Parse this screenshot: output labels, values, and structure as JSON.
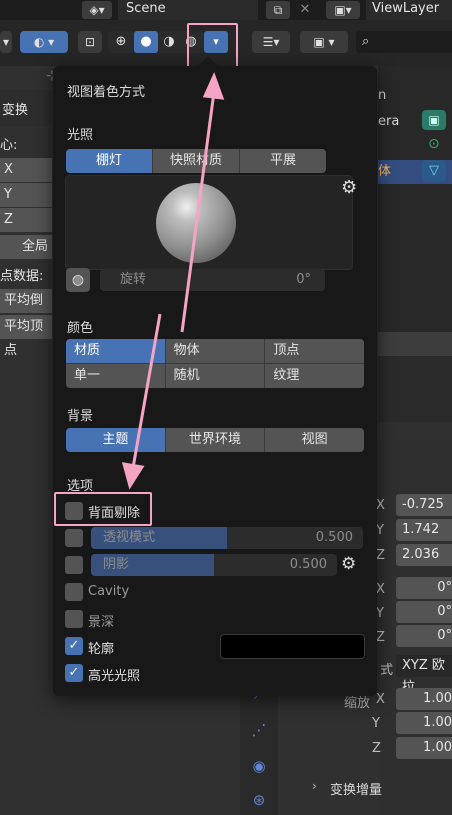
{
  "topbar": {
    "scene_label": "Scene",
    "viewlayer_label": "ViewLayer"
  },
  "left_panel": {
    "title": "变换",
    "center_label": "心:",
    "axes": [
      "X",
      "Y",
      "Z"
    ],
    "global_btn": "全局",
    "vertex_data_label": "点数据:",
    "avg_bevel": "平均倒角",
    "avg_vertex": "平均顶点"
  },
  "outliner": {
    "row_n": "n",
    "row_camera": "era",
    "row_selected": "体"
  },
  "popup": {
    "title": "视图着色方式",
    "lighting": {
      "label": "光照",
      "options": [
        "棚灯",
        "快照材质",
        "平展"
      ],
      "selected": "棚灯",
      "rotation_label": "旋转",
      "rotation_value": "0°"
    },
    "color": {
      "label": "颜色",
      "options": [
        "材质",
        "物体",
        "顶点",
        "单一",
        "随机",
        "纹理"
      ],
      "selected": "材质"
    },
    "background": {
      "label": "背景",
      "options": [
        "主题",
        "世界环境",
        "视图"
      ],
      "selected": "主题"
    },
    "options": {
      "label": "选项",
      "backface_culling": "背面剔除",
      "xray_label": "透视模式",
      "xray_value": "0.500",
      "xray_fraction": 0.5,
      "shadow_label": "阴影",
      "shadow_value": "0.500",
      "shadow_fraction": 0.5,
      "cavity": "Cavity",
      "dof": "景深",
      "outline": "轮廓",
      "specular": "高光光照",
      "outline_color": "#000000"
    }
  },
  "props": {
    "loc_x": "-0.725",
    "loc_y": "1.742",
    "loc_z": "2.036",
    "rot_x": "0°",
    "rot_y": "0°",
    "rot_z": "0°",
    "mode_label": "式",
    "mode_value": "XYZ 欧拉",
    "scale_label": "缩放",
    "scale_x": "1.00",
    "scale_y": "1.00",
    "scale_z": "1.00",
    "axes": [
      "X",
      "Y",
      "Z"
    ],
    "delta_label": "变换增量"
  },
  "colors": {
    "accent": "#4772b3",
    "annotation": "#f5a4c6"
  }
}
